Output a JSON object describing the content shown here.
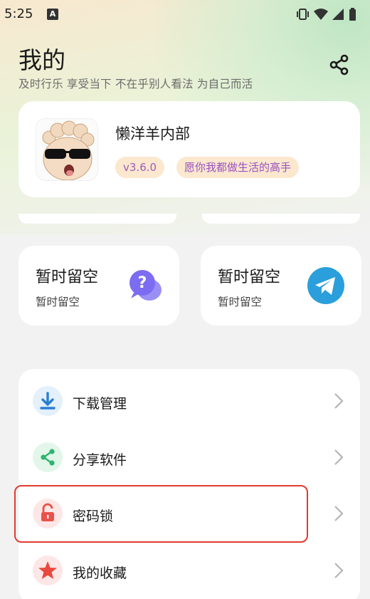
{
  "status_bar": {
    "time": "5:25",
    "notification_letter": "A",
    "icons": [
      "vibrate-icon",
      "wifi-icon",
      "signal-icon",
      "battery-icon"
    ]
  },
  "header": {
    "title": "我的",
    "subtitle": "及时行乐 享受当下 不在乎别人看法 为自己而活",
    "share_icon": "share-icon"
  },
  "profile": {
    "name": "懒洋羊内部",
    "version": "v3.6.0",
    "motto": "愿你我都做生活的高手"
  },
  "feature_cards": [
    {
      "title": "暂时留空",
      "subtitle": "暂时留空",
      "icon": "help-chat-icon",
      "color": "#7b6cf2"
    },
    {
      "title": "暂时留空",
      "subtitle": "暂时留空",
      "icon": "telegram-icon",
      "color": "#2a9fdc"
    }
  ],
  "menu": {
    "items": [
      {
        "label": "下载管理",
        "icon": "download-icon",
        "color": "#2a7fd4",
        "bg": "#e4f0fb"
      },
      {
        "label": "分享软件",
        "icon": "share-nodes-icon",
        "color": "#2db56e",
        "bg": "#e3f6ea"
      },
      {
        "label": "密码锁",
        "icon": "lock-open-icon",
        "color": "#e9524a",
        "bg": "#fde7e6"
      },
      {
        "label": "我的收藏",
        "icon": "star-icon",
        "color": "#e9483f",
        "bg": "#fde7e6"
      }
    ],
    "highlighted": "密码锁"
  },
  "colors": {
    "accent_badge_text": "#9a4fc2",
    "badge_bg": "#fbe8cf",
    "highlight_border": "#e23a30"
  }
}
